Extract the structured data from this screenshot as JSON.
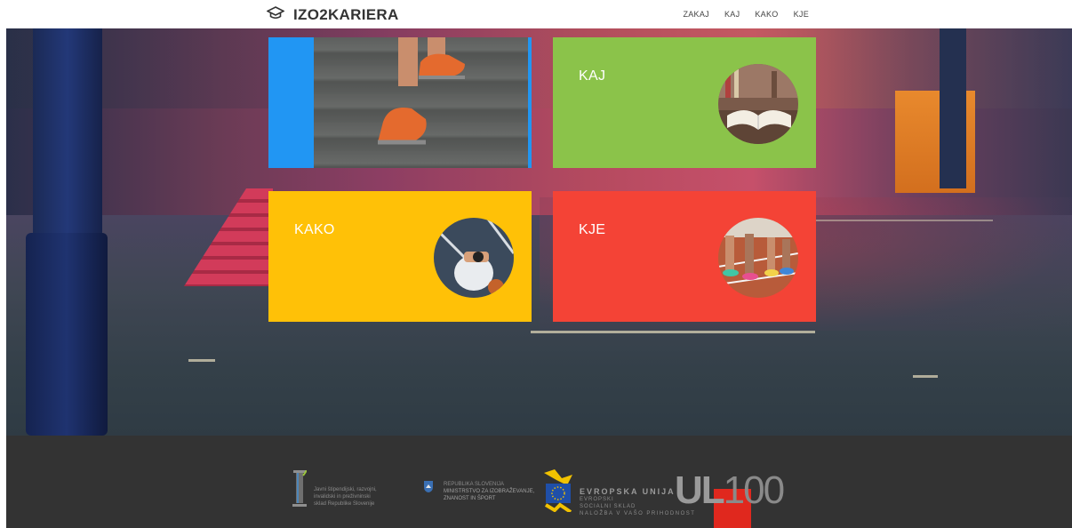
{
  "header": {
    "brand": "IZO2KARIERA",
    "nav": [
      "ZAKAJ",
      "KAJ",
      "KAKO",
      "KJE"
    ]
  },
  "cards": {
    "kaj": {
      "label": "KAJ",
      "color": "#8bc34a"
    },
    "kako": {
      "label": "KAKO",
      "color": "#ffc107"
    },
    "kje": {
      "label": "KJE",
      "color": "#f44336"
    },
    "zakaj": {
      "color": "#2196f3"
    }
  },
  "footer": {
    "sklad": [
      "Javni štipendijski, razvojni,",
      "invalidski in preživninski",
      "sklad Republike Slovenije"
    ],
    "ministrstvo": [
      "REPUBLIKA SLOVENIJA",
      "MINISTRSTVO ZA IZOBRAŽEVANJE,",
      "ZNANOST IN ŠPORT"
    ],
    "eu": {
      "title": "EVROPSKA UNIJA",
      "lines": [
        "EVROPSKI",
        "SOCIALNI SKLAD",
        "NALOŽBA V VAŠO PRIHODNOST"
      ]
    },
    "ul": {
      "prefix": "UL",
      "number": "100"
    }
  }
}
